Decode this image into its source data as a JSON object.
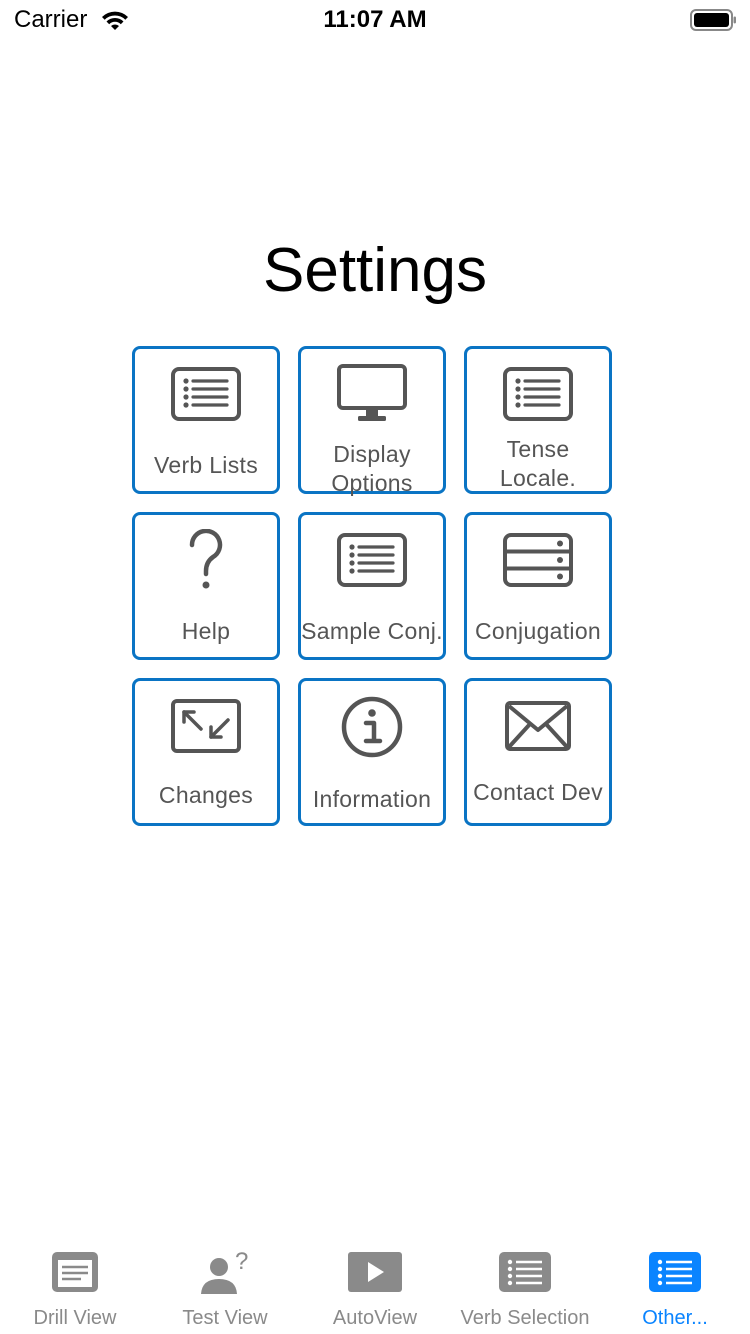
{
  "status_bar": {
    "carrier": "Carrier",
    "time": "11:07 AM"
  },
  "page": {
    "title": "Settings"
  },
  "tiles": [
    {
      "label": "Verb Lists",
      "icon": "list-icon"
    },
    {
      "label": "Display\nOptions",
      "icon": "monitor-icon"
    },
    {
      "label": "Tense\nLocale.",
      "icon": "list-icon"
    },
    {
      "label": "Help",
      "icon": "question-icon"
    },
    {
      "label": "Sample Conj.",
      "icon": "list-icon"
    },
    {
      "label": "Conjugation",
      "icon": "server-icon"
    },
    {
      "label": "Changes",
      "icon": "arrows-in-icon"
    },
    {
      "label": "Information",
      "icon": "info-icon"
    },
    {
      "label": "Contact Dev",
      "icon": "envelope-icon"
    }
  ],
  "tab_bar": {
    "tabs": [
      {
        "label": "Drill View",
        "icon": "document-icon"
      },
      {
        "label": "Test View",
        "icon": "person-question-icon"
      },
      {
        "label": "AutoView",
        "icon": "play-icon"
      },
      {
        "label": "Verb Selection",
        "icon": "list-icon"
      },
      {
        "label": "Other...",
        "icon": "list-icon"
      }
    ],
    "active_index": 4
  },
  "colors": {
    "tile_border": "#0a74c4",
    "tab_active": "#0a84ff",
    "tab_inactive": "#8a8a8a",
    "icon_gray": "#555555"
  }
}
